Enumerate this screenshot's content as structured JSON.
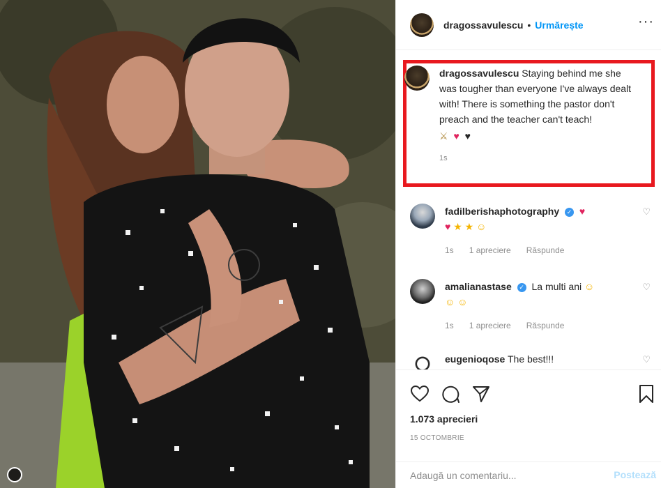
{
  "post": {
    "author": "dragossavulescu",
    "follow_label": "Urmărește",
    "separator": "•",
    "more_label": "···"
  },
  "caption": {
    "username": "dragossavulescu",
    "text": " Staying behind me she was tougher than everyone I've always dealt with! There is something the pastor don't preach and the teacher can't teach!",
    "emojis": [
      "crossed-swords",
      "red-heart",
      "black-heart"
    ],
    "time": "1s"
  },
  "comments": [
    {
      "username": "fadilberishaphotography",
      "text": "",
      "emojis": [
        "red-heart",
        "red-heart",
        "star",
        "star",
        "smiling-face-with-hearts"
      ],
      "time": "1s",
      "likes": "1 apreciere",
      "reply": "Răspunde"
    },
    {
      "username": "amalianastase",
      "text": "La multi ani",
      "emojis": [
        "hugging-face",
        "hugging-face",
        "hugging-face"
      ],
      "time": "1s",
      "likes": "1 apreciere",
      "reply": "Răspunde"
    },
    {
      "username": "eugenioqose",
      "text": "The best!!!",
      "emojis": [],
      "time": "",
      "likes": "",
      "reply": ""
    }
  ],
  "actions": {
    "likes_count": "1.073 aprecieri",
    "date": "15 octombrie"
  },
  "composer": {
    "placeholder": "Adaugă un comentariu...",
    "post_label": "Postează"
  },
  "colors": {
    "accent": "#0095f6",
    "highlight_border": "#e8191f",
    "muted": "#8e8e8e"
  }
}
